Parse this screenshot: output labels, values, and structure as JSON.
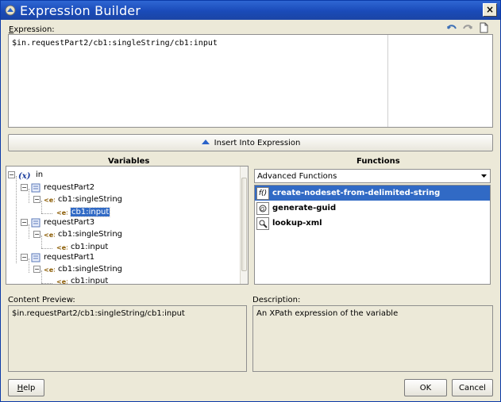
{
  "window": {
    "title": "Expression Builder",
    "close_glyph": "×"
  },
  "expression": {
    "label": "Expression:",
    "label_access_key": "E",
    "label_rest": "xpression:",
    "value": "$in.requestPart2/cb1:singleString/cb1:input"
  },
  "toolbar": {
    "icons": [
      "undo-icon",
      "redo-icon",
      "clear-document-icon"
    ]
  },
  "insert_button": {
    "label": "Insert Into Expression"
  },
  "variables": {
    "title": "Variables",
    "tree": [
      {
        "label": "in",
        "level": 0,
        "expander": "−",
        "icon": "variable-x-icon"
      },
      {
        "label": "requestPart2",
        "level": 1,
        "expander": "−",
        "icon": "part-icon"
      },
      {
        "label": "cb1:singleString",
        "level": 2,
        "expander": "−",
        "icon": "element-icon"
      },
      {
        "label": "cb1:input",
        "level": 3,
        "expander": "",
        "icon": "element-icon",
        "selected": true
      },
      {
        "label": "requestPart3",
        "level": 1,
        "expander": "−",
        "icon": "part-icon"
      },
      {
        "label": "cb1:singleString",
        "level": 2,
        "expander": "−",
        "icon": "element-icon"
      },
      {
        "label": "cb1:input",
        "level": 3,
        "expander": "",
        "icon": "element-icon"
      },
      {
        "label": "requestPart1",
        "level": 1,
        "expander": "−",
        "icon": "part-icon"
      },
      {
        "label": "cb1:singleString",
        "level": 2,
        "expander": "−",
        "icon": "element-icon"
      },
      {
        "label": "cb1:input",
        "level": 3,
        "expander": "",
        "icon": "element-icon"
      }
    ]
  },
  "functions": {
    "title": "Functions",
    "category": "Advanced Functions",
    "items": [
      {
        "label": "create-nodeset-from-delimited-string",
        "icon": "function-fx-icon",
        "icon_glyph": "f()",
        "selected": true
      },
      {
        "label": "generate-guid",
        "icon": "generate-guid-icon",
        "icon_glyph": ""
      },
      {
        "label": "lookup-xml",
        "icon": "lookup-xml-icon",
        "icon_glyph": ""
      }
    ]
  },
  "content_preview": {
    "label": "Content Preview:",
    "value": "$in.requestPart2/cb1:singleString/cb1:input"
  },
  "description": {
    "label": "Description:",
    "value": "An XPath expression of the variable"
  },
  "buttons": {
    "help": "Help",
    "help_access_key": "H",
    "help_rest": "elp",
    "ok": "OK",
    "cancel": "Cancel"
  },
  "colors": {
    "selection": "#316ac5",
    "title_bar": "#1a4bb8",
    "dialog_bg": "#ece9d8"
  }
}
